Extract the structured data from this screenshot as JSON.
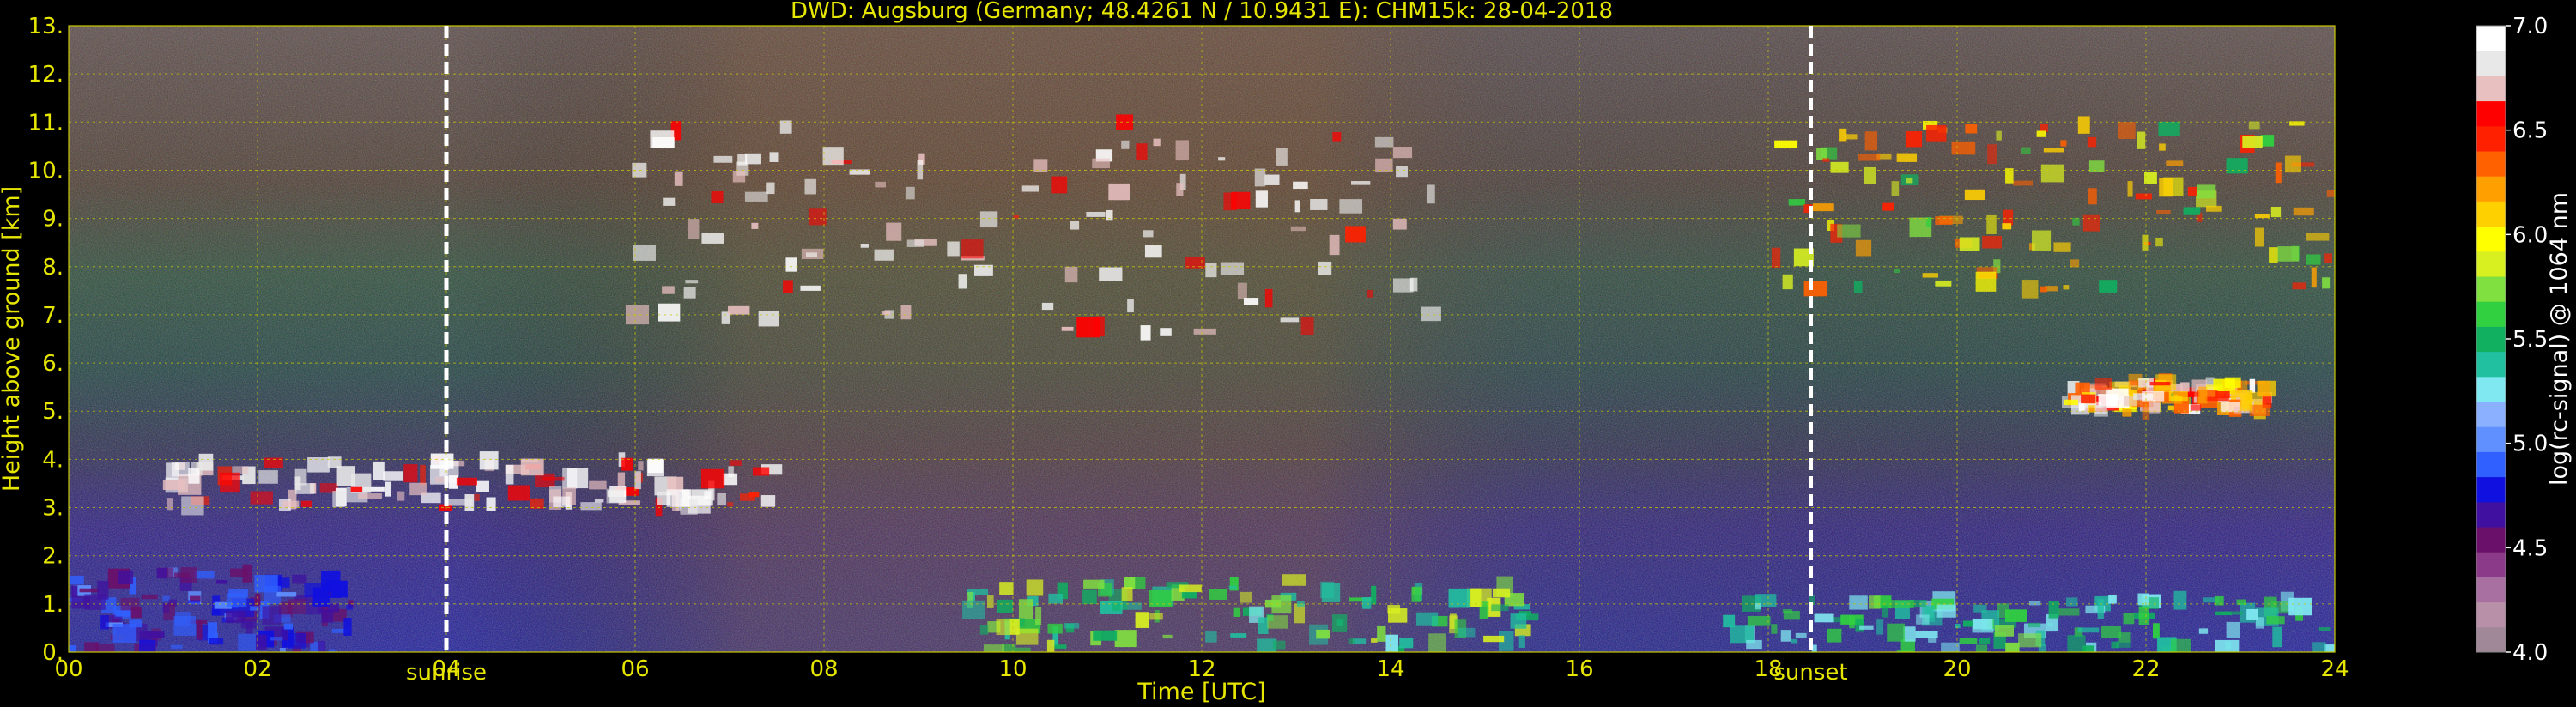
{
  "chart_data": {
    "type": "heatmap",
    "title": "DWD: Augsburg (Germany; 48.4261 N / 10.9431 E):    CHM15k: 28-04-2018",
    "xlabel": "Time [UTC]",
    "ylabel": "Height above ground [km]",
    "xlim": [
      0,
      24
    ],
    "ylim": [
      0,
      13
    ],
    "x_ticks": [
      "00",
      "02",
      "04",
      "06",
      "08",
      "10",
      "12",
      "14",
      "16",
      "18",
      "20",
      "22",
      "24"
    ],
    "y_ticks": [
      "0.",
      "1.",
      "2.",
      "3.",
      "4.",
      "5.",
      "6.",
      "7.",
      "8.",
      "9.",
      "10.",
      "11.",
      "12.",
      "13."
    ],
    "grid": true,
    "markers": [
      {
        "label": "sunrise",
        "time": 4.0
      },
      {
        "label": "sunset",
        "time": 18.45
      }
    ],
    "colorbar": {
      "label": "log(rc-signal) @ 1064 nm",
      "ticks": [
        "4.0",
        "4.5",
        "5.0",
        "5.5",
        "6.0",
        "6.5",
        "7.0"
      ],
      "range": [
        4.0,
        7.0
      ],
      "colors": [
        "#a08898",
        "#b890a8",
        "#a870a0",
        "#8a3a88",
        "#6a106a",
        "#4010a0",
        "#1010e0",
        "#3060ff",
        "#6090ff",
        "#8ab0ff",
        "#80e8f0",
        "#20c0a0",
        "#10b060",
        "#30d040",
        "#80e040",
        "#d8f020",
        "#ffff00",
        "#ffd000",
        "#ffa000",
        "#ff6000",
        "#ff2000",
        "#ff0000",
        "#e8c0c0",
        "#e8e8e8",
        "#ffffff"
      ]
    },
    "features": [
      {
        "name": "cirrus-clouds-day",
        "time": [
          6.0,
          14.5
        ],
        "height": [
          6.6,
          11.0
        ],
        "signal": [
          6.5,
          7.0
        ]
      },
      {
        "name": "cirrus-clouds-evening",
        "time": [
          18.0,
          24.0
        ],
        "height": [
          7.5,
          11.0
        ],
        "signal": [
          5.5,
          6.5
        ]
      },
      {
        "name": "mid-level-cloud-layer",
        "time": [
          1.0,
          7.5
        ],
        "height": [
          3.0,
          4.0
        ],
        "signal": [
          6.5,
          7.0
        ]
      },
      {
        "name": "mid-level-cloud-patches",
        "time": [
          21.2,
          23.3
        ],
        "height": [
          5.0,
          5.6
        ],
        "signal": [
          6.0,
          7.0
        ]
      },
      {
        "name": "residual-layer",
        "time": [
          0.0,
          3.0
        ],
        "height": [
          0.0,
          1.7
        ],
        "signal": [
          4.5,
          5.0
        ]
      },
      {
        "name": "boundary-layer-convective",
        "time": [
          9.5,
          15.5
        ],
        "height": [
          0.0,
          1.5
        ],
        "signal": [
          5.3,
          5.9
        ]
      },
      {
        "name": "evening-boundary-layer",
        "time": [
          17.5,
          24.0
        ],
        "height": [
          0.0,
          1.1
        ],
        "signal": [
          5.2,
          5.7
        ]
      }
    ]
  }
}
